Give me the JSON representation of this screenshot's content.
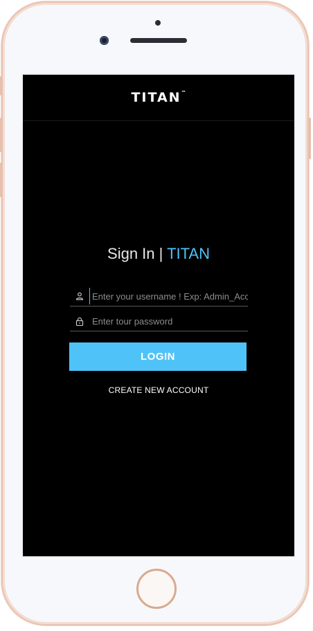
{
  "header": {
    "brand": "TITAN",
    "brand_mark": "™"
  },
  "signin": {
    "title_prefix": "Sign In | ",
    "title_accent": "TITAN"
  },
  "form": {
    "username": {
      "icon": "person-icon",
      "placeholder": "Enter your username ! Exp: Admin_Account",
      "value": ""
    },
    "password": {
      "icon": "lock-icon",
      "placeholder": "Enter tour password",
      "value": ""
    },
    "login_label": "LOGIN",
    "create_account_label": "CREATE NEW ACCOUNT"
  },
  "colors": {
    "accent": "#4fc3f7",
    "background": "#000000",
    "frame": "#e8c3b2"
  }
}
